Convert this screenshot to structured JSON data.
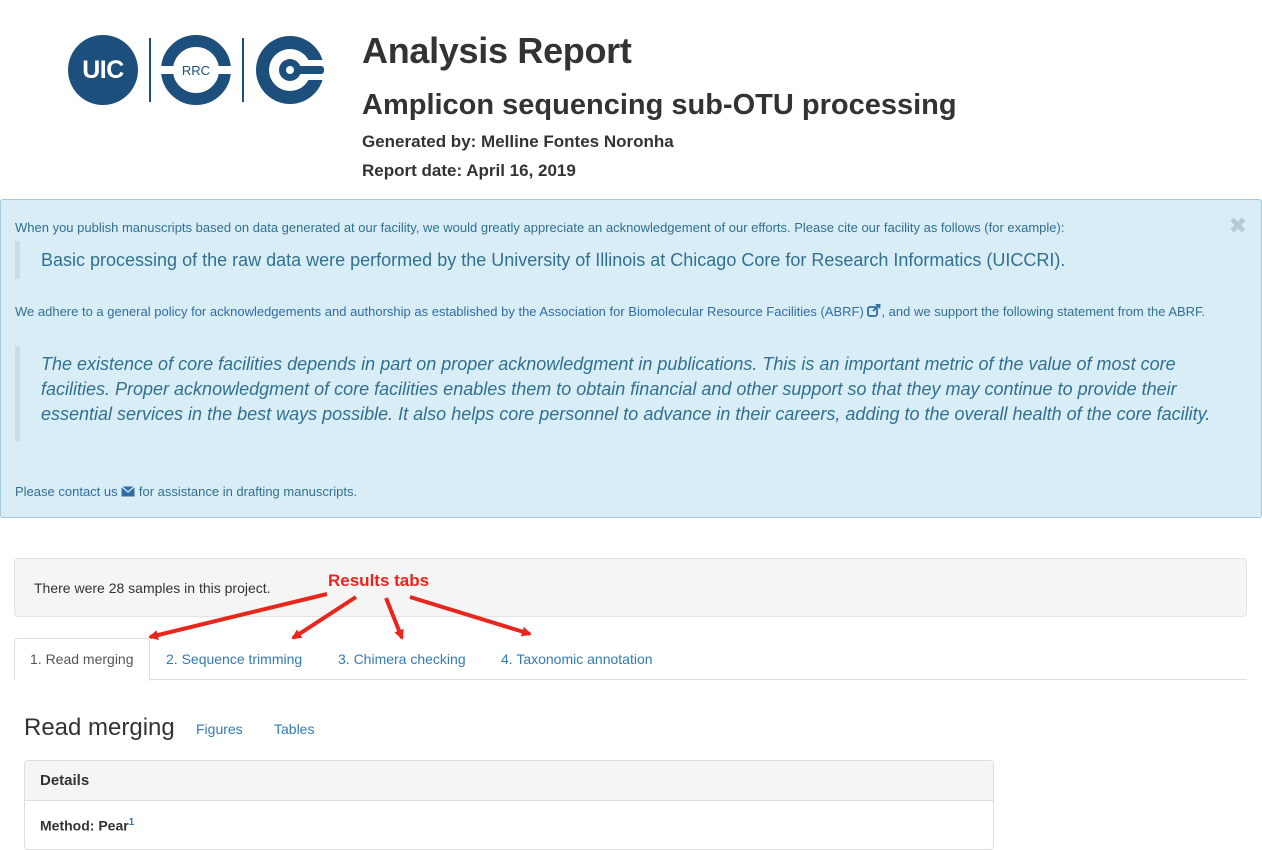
{
  "header": {
    "logos": {
      "uic": "UIC",
      "rrc": "RRC"
    },
    "title": "Analysis Report",
    "subtitle": "Amplicon sequencing sub-OTU processing",
    "generated_by": "Generated by: Melline Fontes Noronha",
    "report_date": "Report date: April 16, 2019"
  },
  "alert": {
    "close_glyph": "✖",
    "intro": "When you publish manuscripts based on data generated at our facility, we would greatly appreciate an acknowledgement of our efforts. Please cite our facility as follows (for example):",
    "citation": "Basic processing of the raw data were performed by the University of Illinois at Chicago Core for Research Informatics (UICCRI).",
    "policy_prefix": "We adhere to a ",
    "policy_link": "general policy for acknowledgements and authorship as established by the Association for Biomolecular Resource Facilities (ABRF)",
    "policy_suffix": ", and we support the following statement from the ABRF.",
    "abrf_quote": "The existence of core facilities depends in part on proper acknowledgment in publications. This is an important metric of the value of most core facilities. Proper acknowledgment of core facilities enables them to obtain financial and other support so that they may continue to provide their essential services in the best ways possible. It also helps core personnel to advance in their careers, adding to the overall health of the core facility.",
    "contact_prefix": "Please ",
    "contact_link": "contact us",
    "contact_suffix": " for assistance in drafting manuscripts."
  },
  "well": {
    "text": "There were 28 samples in this project."
  },
  "annotation": {
    "label": "Results tabs",
    "color": "#e8261c"
  },
  "tabs": [
    {
      "label": "1. Read merging",
      "active": true
    },
    {
      "label": "2. Sequence trimming",
      "active": false
    },
    {
      "label": "3. Chimera checking",
      "active": false
    },
    {
      "label": "4. Taxonomic annotation",
      "active": false
    }
  ],
  "section": {
    "title": "Read merging",
    "links": [
      "Figures",
      "Tables"
    ],
    "panel_heading": "Details",
    "method_label": "Method: Pear",
    "method_ref": "1"
  },
  "colors": {
    "brand_blue": "#1d4f7c",
    "alert_bg": "#d9edf7",
    "alert_text": "#31708f",
    "link": "#337ab7"
  }
}
